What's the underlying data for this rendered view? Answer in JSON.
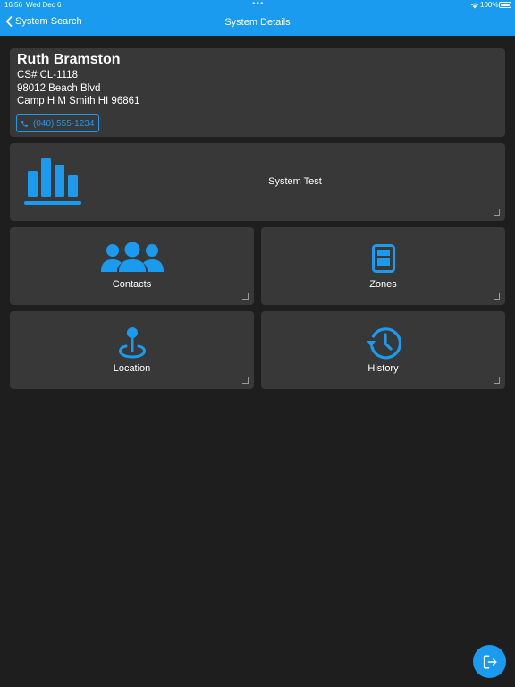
{
  "status_bar": {
    "time": "16:56",
    "date": "Wed Dec 6",
    "battery": "100%"
  },
  "nav": {
    "back_label": "System Search",
    "title": "System Details"
  },
  "customer": {
    "name": "Ruth Bramston",
    "account": "CS# CL-1118",
    "address_line1": "98012 Beach Blvd",
    "address_line2": "Camp H M Smith HI 96861",
    "phone": "(040) 555-1234"
  },
  "tiles": {
    "system_test": {
      "label": "System Test",
      "icon": "bar-chart-icon"
    },
    "contacts": {
      "label": "Contacts",
      "icon": "group-icon"
    },
    "zones": {
      "label": "Zones",
      "icon": "zone-panel-icon"
    },
    "location": {
      "label": "Location",
      "icon": "map-pin-icon"
    },
    "history": {
      "label": "History",
      "icon": "history-icon"
    }
  },
  "fab": {
    "icon": "exit-icon"
  },
  "colors": {
    "accent": "#1a9bf0",
    "background": "#1e1e1e",
    "card": "#383838"
  }
}
